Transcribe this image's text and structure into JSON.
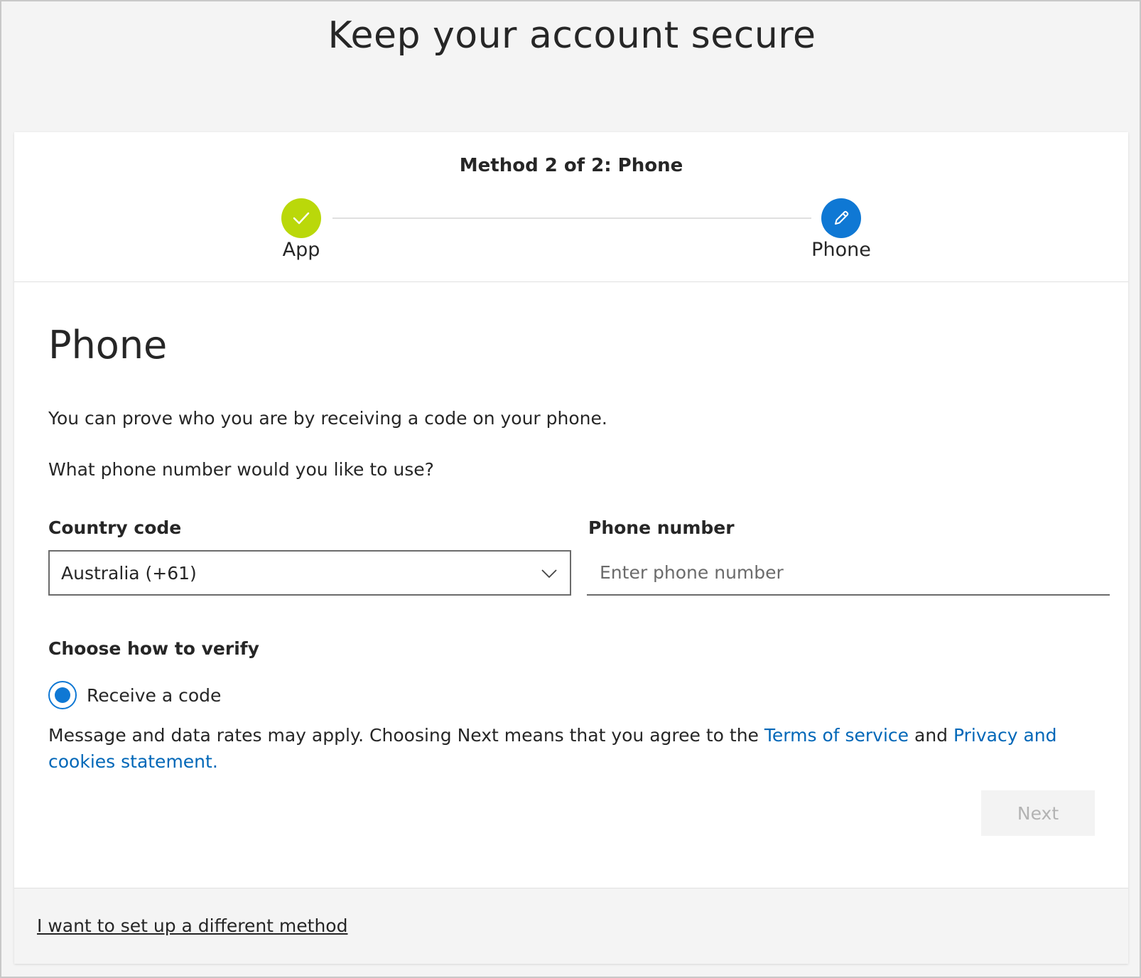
{
  "page": {
    "title": "Keep your account secure"
  },
  "stepper": {
    "heading": "Method 2 of 2: Phone",
    "steps": [
      {
        "label": "App",
        "status": "complete",
        "icon": "checkmark-icon",
        "color": "#bad80a"
      },
      {
        "label": "Phone",
        "status": "current",
        "icon": "pencil-icon",
        "color": "#0f78d4"
      }
    ]
  },
  "section": {
    "title": "Phone",
    "description": "You can prove who you are by receiving a code on your phone.",
    "question": "What phone number would you like to use?"
  },
  "form": {
    "country_label": "Country code",
    "country_value": "Australia (+61)",
    "phone_label": "Phone number",
    "phone_value": "",
    "phone_placeholder": "Enter phone number",
    "verify_title": "Choose how to verify",
    "verify_option": "Receive a code",
    "verify_selected": true
  },
  "disclaimer": {
    "text_before": "Message and data rates may apply. Choosing Next means that you agree to the ",
    "terms_link": "Terms of service",
    "text_middle": " and ",
    "privacy_link": "Privacy and cookies statement."
  },
  "actions": {
    "next_label": "Next",
    "next_enabled": false
  },
  "footer": {
    "alt_method_link": "I want to set up a different method"
  },
  "colors": {
    "accent": "#0f78d4",
    "success": "#bad80a",
    "link": "#0067b8"
  }
}
